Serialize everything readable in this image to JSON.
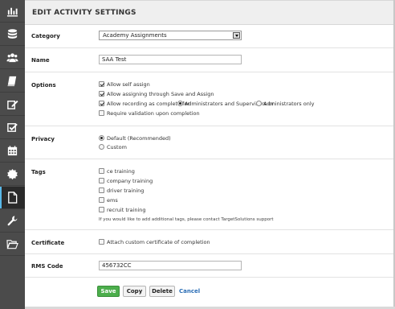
{
  "sidebar": {
    "items": [
      {
        "icon": "bar-chart-icon",
        "active": false
      },
      {
        "icon": "database-icon",
        "active": false
      },
      {
        "icon": "users-icon",
        "active": false
      },
      {
        "icon": "book-icon",
        "active": false
      },
      {
        "icon": "edit-icon",
        "active": false
      },
      {
        "icon": "checkbox-icon",
        "active": false
      },
      {
        "icon": "calendar-icon",
        "active": false
      },
      {
        "icon": "badge-icon",
        "active": false
      },
      {
        "icon": "document-icon",
        "active": true
      },
      {
        "icon": "wrench-icon",
        "active": false
      },
      {
        "icon": "folder-open-icon",
        "active": false
      }
    ]
  },
  "page": {
    "title": "EDIT ACTIVITY SETTINGS"
  },
  "form": {
    "category": {
      "label": "Category",
      "value": "Academy Assignments"
    },
    "name": {
      "label": "Name",
      "value": "SAA Test"
    },
    "options": {
      "label": "Options",
      "allow_self_assign": {
        "label": "Allow self assign",
        "checked": true
      },
      "allow_save_assign": {
        "label": "Allow assigning through Save and Assign",
        "checked": true
      },
      "allow_recording": {
        "label": "Allow recording as complete for",
        "checked": true,
        "choice_admins_supervisors": "Administrators and Supervisors or",
        "choice_admins_only": "Administrators only",
        "selected": "admins_supervisors"
      },
      "require_validation": {
        "label": "Require validation upon completion",
        "checked": false
      }
    },
    "privacy": {
      "label": "Privacy",
      "choices": [
        "Default (Recommended)",
        "Custom"
      ],
      "selected": "Default (Recommended)"
    },
    "tags": {
      "label": "Tags",
      "items": [
        "ce training",
        "company training",
        "driver training",
        "ems",
        "recruit training"
      ],
      "note": "If you would like to add additional tags, please contact TargetSolutions support"
    },
    "certificate": {
      "label": "Certificate",
      "option": "Attach custom certificate of completion",
      "checked": false
    },
    "rms_code": {
      "label": "RMS Code",
      "value": "456732CC"
    }
  },
  "actions": {
    "save": "Save",
    "copy": "Copy",
    "delete": "Delete",
    "cancel": "Cancel"
  },
  "colors": {
    "sidebar_bg": "#4b4b4b",
    "active_accent": "#58b8e8",
    "save_green": "#4cae4c",
    "link_blue": "#2a6db5"
  }
}
